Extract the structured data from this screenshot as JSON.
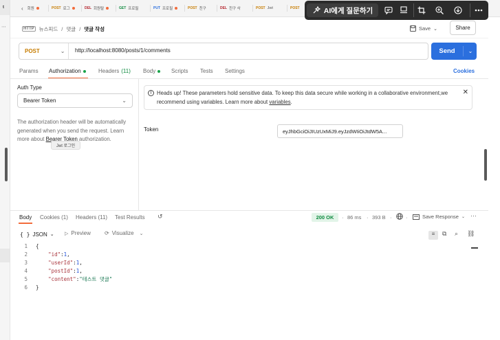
{
  "tab_bar": {
    "tabs": [
      {
        "method": "",
        "label": "회원",
        "dot": true,
        "method_color": "#555555"
      },
      {
        "method": "POST",
        "label": "로그",
        "dot": true,
        "method_color": "#c77c00"
      },
      {
        "method": "DEL",
        "label": "회원탈",
        "dot": true,
        "method_color": "#b4232c"
      },
      {
        "method": "GET",
        "label": "프로필",
        "dot": false,
        "method_color": "#0e8a3f"
      },
      {
        "method": "PUT",
        "label": "프로필",
        "dot": true,
        "method_color": "#2b6fde"
      },
      {
        "method": "POST",
        "label": "친구",
        "dot": false,
        "method_color": "#c77c00"
      },
      {
        "method": "DEL",
        "label": "친구 삭",
        "dot": false,
        "method_color": "#b4232c"
      },
      {
        "method": "POST",
        "label": "Jwt",
        "dot": false,
        "method_color": "#c77c00"
      },
      {
        "method": "POST",
        "label": "",
        "dot": false,
        "method_color": "#c77c00"
      }
    ]
  },
  "overlay_toolbar": {
    "ask_ai_label": "AI에게 질문하기",
    "icons": [
      "chat-icon",
      "pin-icon",
      "crop-icon",
      "zoom-icon",
      "download-icon",
      "more-icon"
    ]
  },
  "breadcrumb": {
    "parts": [
      "뉴스피드",
      "댓글"
    ],
    "current": "댓글 작성"
  },
  "actions": {
    "save_label": "Save",
    "share_label": "Share"
  },
  "request": {
    "method": "POST",
    "url": "http://localhost:8080/posts/1/comments",
    "send_label": "Send"
  },
  "request_tabs": [
    {
      "label": "Params",
      "extra": "",
      "dot": false,
      "active": false
    },
    {
      "label": "Authorization",
      "extra": "",
      "dot": true,
      "active": true
    },
    {
      "label": "Headers",
      "extra": "(11)",
      "dot": false,
      "active": false
    },
    {
      "label": "Body",
      "extra": "",
      "dot": true,
      "active": false
    },
    {
      "label": "Scripts",
      "extra": "",
      "dot": false,
      "active": false
    },
    {
      "label": "Tests",
      "extra": "",
      "dot": false,
      "active": false
    },
    {
      "label": "Settings",
      "extra": "",
      "dot": false,
      "active": false
    }
  ],
  "cookies_label": "Cookies",
  "auth": {
    "type_label": "Auth Type",
    "type_value": "Bearer Token",
    "description": "The authorization header will be automatically generated when you send the request. Learn more about",
    "link": "Bearer Token",
    "description_end": "authorization.",
    "tooltip": "Jwt 로그인"
  },
  "alert": {
    "text": "Heads up! These parameters hold sensitive data. To keep this data secure while working in a collaborative environment,we recommend using variables. Learn more about",
    "link": "variables",
    "end": "."
  },
  "token": {
    "label": "Token",
    "value": "eyJhbGciOiJIUzUxMiJ9.eyJzdWIiOiJtdW5A..."
  },
  "response_tabs": [
    {
      "label": "Body",
      "active": true
    },
    {
      "label": "Cookies (1)",
      "active": false
    },
    {
      "label": "Headers (11)",
      "active": false
    },
    {
      "label": "Test Results",
      "active": false
    }
  ],
  "response_meta": {
    "status": "200 OK",
    "time": "86 ms",
    "size": "393 B",
    "save_response": "Save Response"
  },
  "format": {
    "type": "JSON",
    "preview": "Preview",
    "visualize": "Visualize"
  },
  "response_body": [
    {
      "n": "1",
      "text": "{"
    },
    {
      "n": "2",
      "key": "\"id\"",
      "value": "1",
      "vtype": "num"
    },
    {
      "n": "3",
      "key": "\"userId\"",
      "value": "1",
      "vtype": "num"
    },
    {
      "n": "4",
      "key": "\"postId\"",
      "value": "1",
      "vtype": "num"
    },
    {
      "n": "5",
      "key": "\"content\"",
      "value": "\"테스트 댓글\"",
      "vtype": "str",
      "last": true
    },
    {
      "n": "6",
      "text": "}"
    }
  ]
}
